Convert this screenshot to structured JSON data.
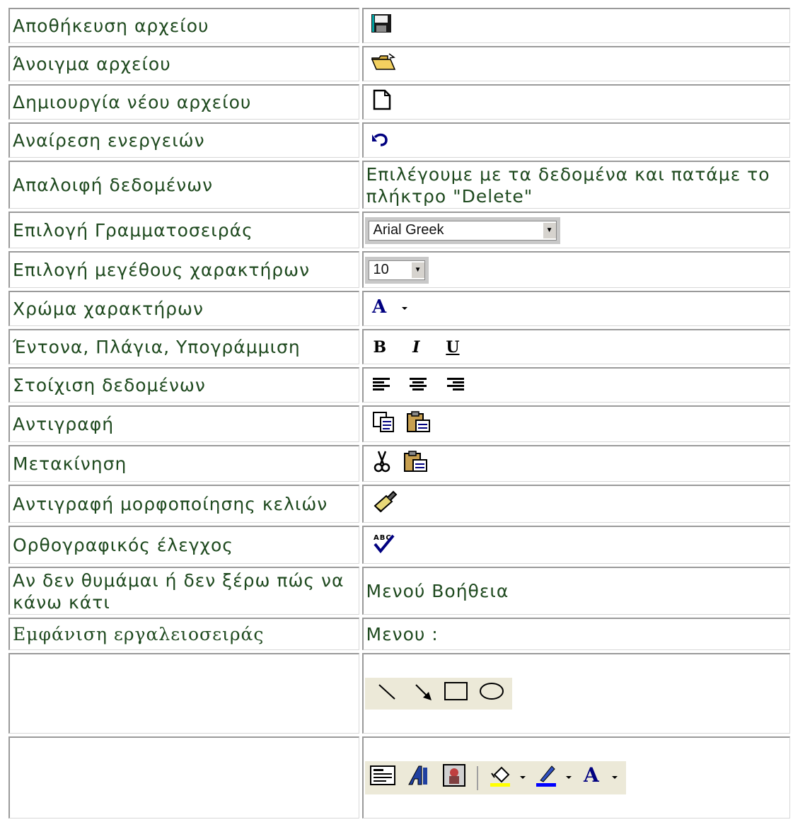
{
  "rows": [
    {
      "label": "Αποθήκευση αρχείου",
      "icon": "save-icon"
    },
    {
      "label": "Άνοιγμα αρχείου",
      "icon": "open-folder-icon"
    },
    {
      "label": "Δημιουργία νέου αρχείου",
      "icon": "new-document-icon"
    },
    {
      "label": "Αναίρεση ενεργειών",
      "icon": "undo-icon"
    },
    {
      "label": "Απαλοιφή δεδομένων",
      "value": "Επιλέγουμε με τα δεδομένα και πατάμε το πλήκτρο \"Delete\""
    },
    {
      "label": "Επιλογή Γραμματοσειράς",
      "font_select": "Arial Greek"
    },
    {
      "label": "Επιλογή μεγέθους χαρακτήρων",
      "size_select": "10"
    },
    {
      "label": "Χρώμα χαρακτήρων",
      "icon": "font-color-icon"
    },
    {
      "label": "Έντονα, Πλάγια, Υπογράμμιση",
      "bold": "B",
      "italic": "I",
      "underline": "U"
    },
    {
      "label": "Στοίχιση δεδομένων",
      "icons": [
        "align-left-icon",
        "align-center-icon",
        "align-right-icon"
      ]
    },
    {
      "label": "Αντιγραφή",
      "icons": [
        "copy-icon",
        "paste-icon"
      ]
    },
    {
      "label": "Μετακίνηση",
      "icons": [
        "cut-icon",
        "paste-icon"
      ]
    },
    {
      "label": "Αντιγραφή μορφοποίησης κελιών",
      "icon": "format-painter-icon"
    },
    {
      "label": "Ορθογραφικός έλεγχος",
      "icon": "spellcheck-icon",
      "icon_text": "ABC"
    },
    {
      "label": "Αν δεν θυμάμαι ή δεν ξέρω πώς να κάνω κάτι",
      "value": "Μενού Βοήθεια"
    },
    {
      "label": "Εμφάνιση εργαλειοσειράς",
      "value": "Μενου :"
    },
    {
      "label": "",
      "icons": [
        "line-icon",
        "arrow-icon",
        "rectangle-icon",
        "oval-icon"
      ]
    },
    {
      "label": "",
      "icons": [
        "text-box-icon",
        "wordart-icon",
        "clip-art-icon",
        "fill-color-icon",
        "line-color-icon",
        "font-color-icon"
      ],
      "font_glyph": "A"
    }
  ],
  "colors": {
    "text": "#1f4a1f",
    "border": "#9a9a9a",
    "toolbar_bg": "#ece9d8",
    "icon_blue": "#000080"
  }
}
